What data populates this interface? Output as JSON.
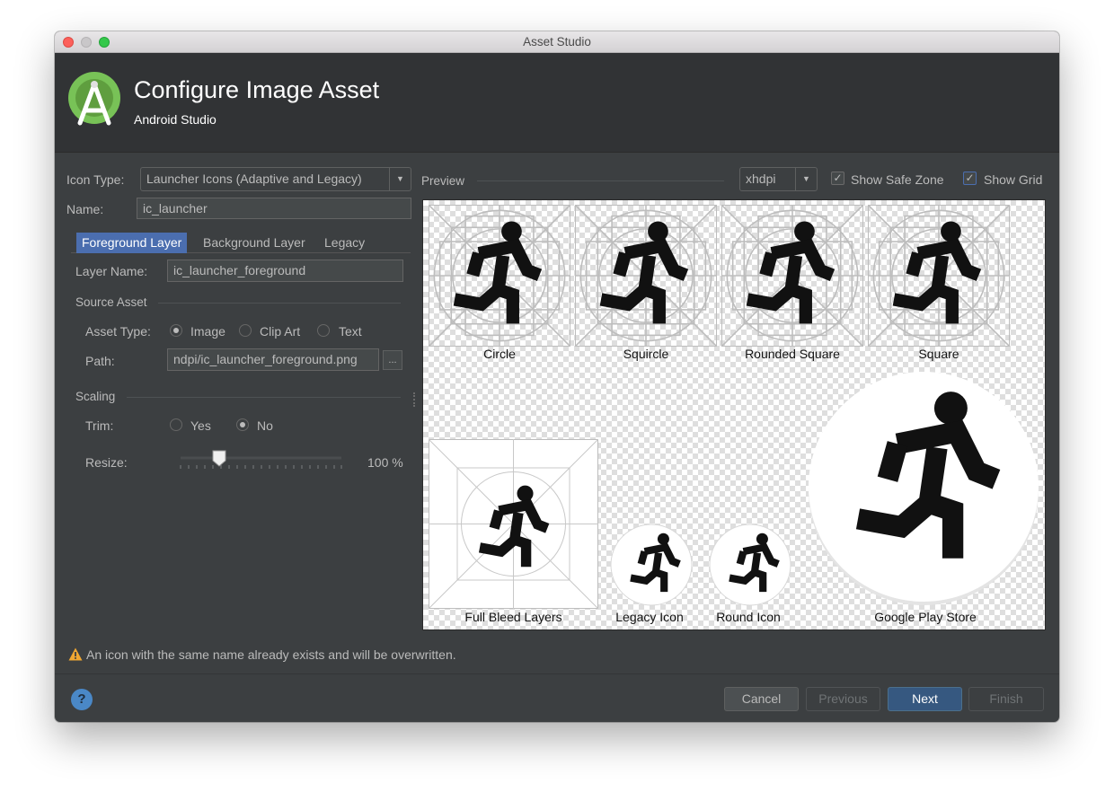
{
  "window": {
    "title": "Asset Studio"
  },
  "header": {
    "title": "Configure Image Asset",
    "subtitle": "Android Studio"
  },
  "icon_type": {
    "label": "Icon Type:",
    "value": "Launcher Icons (Adaptive and Legacy)"
  },
  "name_field": {
    "label": "Name:",
    "value": "ic_launcher"
  },
  "tabs": [
    {
      "label": "Foreground Layer",
      "active": true
    },
    {
      "label": "Background Layer",
      "active": false
    },
    {
      "label": "Legacy",
      "active": false
    }
  ],
  "layer_name": {
    "label": "Layer Name:",
    "value": "ic_launcher_foreground"
  },
  "source_asset": {
    "section_label": "Source Asset",
    "asset_type_label": "Asset Type:",
    "options": [
      "Image",
      "Clip Art",
      "Text"
    ],
    "selected": "Image",
    "path_label": "Path:",
    "path_value": "ndpi/ic_launcher_foreground.png",
    "browse_label": "..."
  },
  "scaling": {
    "section_label": "Scaling",
    "trim_label": "Trim:",
    "trim_options": [
      "Yes",
      "No"
    ],
    "trim_selected": "No",
    "resize_label": "Resize:",
    "resize_value": 100,
    "resize_text": "100 %"
  },
  "preview": {
    "label": "Preview",
    "density": "xhdpi",
    "show_safe_zone": {
      "label": "Show Safe Zone",
      "checked": true
    },
    "show_grid": {
      "label": "Show Grid",
      "checked": true
    },
    "labels": {
      "circle": "Circle",
      "squircle": "Squircle",
      "rounded_square": "Rounded Square",
      "square": "Square",
      "full_bleed": "Full Bleed Layers",
      "legacy": "Legacy Icon",
      "round": "Round Icon",
      "play_store": "Google Play Store"
    }
  },
  "warning": "An icon with the same name already exists and will be overwritten.",
  "buttons": {
    "help": "?",
    "cancel": "Cancel",
    "previous": "Previous",
    "next": "Next",
    "finish": "Finish"
  },
  "colors": {
    "accent": "#4b6eaf",
    "android_green": "#78c257",
    "dialog_bg": "#3c3f41",
    "warning": "#f0a732"
  },
  "icons": {
    "logo": "android-studio-logo",
    "figure": "running-person",
    "warning": "warning-triangle",
    "help": "help-circle"
  }
}
